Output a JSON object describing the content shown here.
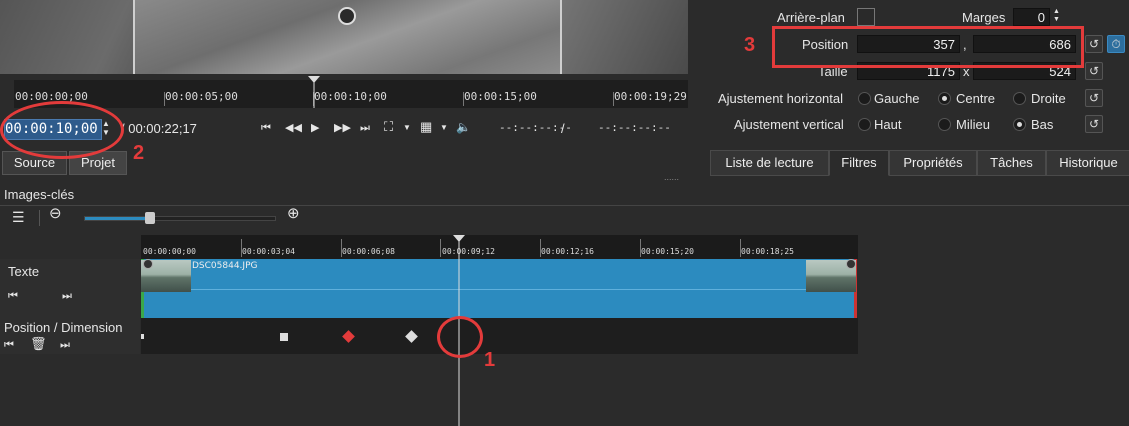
{
  "ruler_top": {
    "ticks": [
      "00:00:00;00",
      "00:00:05;00",
      "00:00:10;00",
      "00:00:15;00",
      "00:00:19;29"
    ]
  },
  "timecode": {
    "current": "00:00:10;00",
    "total": "/ 00:00:22;17",
    "in": "--:--:--:--",
    "out": "--:--:--:--",
    "sep": "/"
  },
  "source_tabs": {
    "source": "Source",
    "projet": "Projet"
  },
  "filter": {
    "arriere_plan": "Arrière-plan",
    "marges_label": "Marges",
    "marges_value": "0",
    "position_label": "Position",
    "position_x": "357",
    "position_y": "686",
    "comma": ",",
    "taille_label": "Taille",
    "taille_w": "1175",
    "taille_h": "524",
    "x": "x",
    "ajust_h_label": "Ajustement horizontal",
    "h_options": [
      "Gauche",
      "Centre",
      "Droite"
    ],
    "h_selected": "Centre",
    "ajust_v_label": "Ajustement vertical",
    "v_options": [
      "Haut",
      "Milieu",
      "Bas"
    ],
    "v_selected": "Bas"
  },
  "panel_tabs": [
    "Liste de lecture",
    "Filtres",
    "Propriétés",
    "Tâches",
    "Historique"
  ],
  "keyframes": {
    "title": "Images-clés",
    "ruler": [
      "00:00:00;00",
      "00:00:03;04",
      "00:00:06;08",
      "00:00:09;12",
      "00:00:12;16",
      "00:00:15;20",
      "00:00:18;25"
    ],
    "track1": "Texte",
    "track2": "Position / Dimension",
    "clip": "DSC05844.JPG"
  },
  "annotations": [
    "1",
    "2",
    "3"
  ],
  "colors": {
    "accent": "#2c8bbf",
    "annotation": "#e33b3b",
    "timecode_bg": "#2e5b8c"
  }
}
